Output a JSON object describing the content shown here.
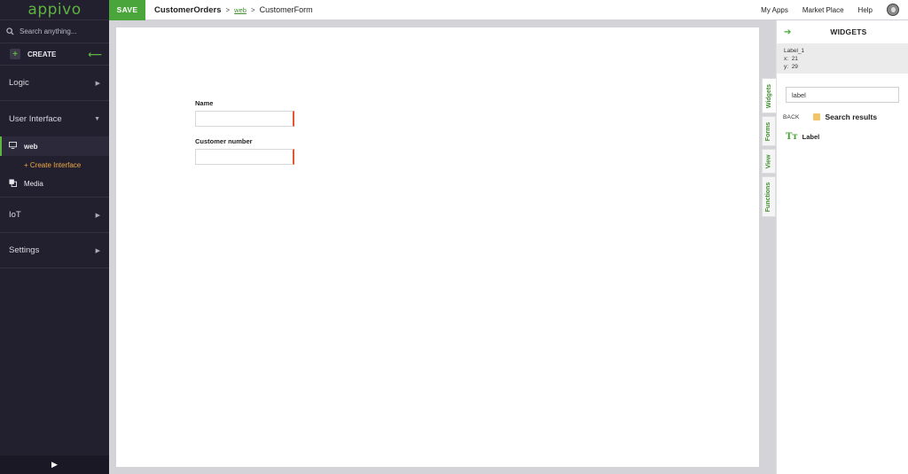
{
  "brand": {
    "logo": "appivo"
  },
  "sidebar": {
    "search_placeholder": "Search anything...",
    "create_label": "CREATE",
    "sections": {
      "logic": "Logic",
      "user_interface": "User Interface",
      "iot": "IoT",
      "settings": "Settings"
    },
    "ui_items": {
      "web": "web",
      "create_interface": "+ Create Interface",
      "media": "Media"
    }
  },
  "topbar": {
    "save_label": "SAVE",
    "breadcrumb": {
      "app": "CustomerOrders",
      "sep1": ">",
      "link": "web",
      "sep2": ">",
      "form": "CustomerForm"
    },
    "links": {
      "my_apps": "My Apps",
      "market_place": "Market Place",
      "help": "Help"
    }
  },
  "canvas": {
    "fields": [
      {
        "label": "Name",
        "value": ""
      },
      {
        "label": "Customer number",
        "value": ""
      }
    ]
  },
  "vtabs": [
    "Widgets",
    "Forms",
    "View",
    "Functions"
  ],
  "panel": {
    "title": "WIDGETS",
    "selection": {
      "name": "Label_1",
      "x_label": "x:",
      "x": "21",
      "y_label": "y:",
      "y": "29"
    },
    "search_value": "label",
    "back_label": "BACK",
    "results_title": "Search results",
    "result_item": "Label",
    "result_icon": "Tт"
  },
  "colors": {
    "accent": "#4aa53a",
    "sidebar_bg": "#22202f",
    "required": "#e4572e",
    "link_orange": "#f0a840"
  }
}
